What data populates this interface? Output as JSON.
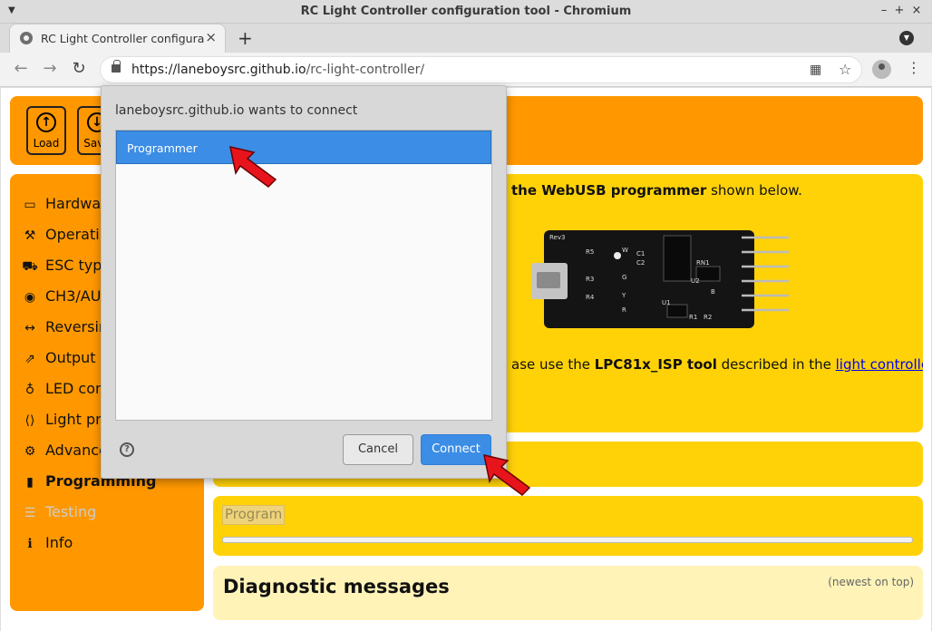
{
  "window": {
    "title": "RC Light Controller configuration tool - Chromium",
    "minimize": "–",
    "maximize": "+",
    "close": "×"
  },
  "tab": {
    "title": "RC Light Controller configuration tool",
    "close": "×",
    "new_tab": "+"
  },
  "omnibox": {
    "scheme_host": "https://laneboysrc.github.io",
    "path": "/rc-light-controller/"
  },
  "header_buttons": [
    {
      "label": "Load",
      "icon": "upload-icon"
    },
    {
      "label": "Save",
      "icon": "download-icon"
    }
  ],
  "sidebar": {
    "items": [
      {
        "label": "Hardware",
        "icon": "hdd-icon"
      },
      {
        "label": "Operating",
        "icon": "wrench-icon"
      },
      {
        "label": "ESC type",
        "icon": "car-icon"
      },
      {
        "label": "CH3/AUX",
        "icon": "toggle-icon"
      },
      {
        "label": "Reversing",
        "icon": "arrows-h-icon"
      },
      {
        "label": "Output functions",
        "icon": "external-link-icon"
      },
      {
        "label": "LED configuration",
        "icon": "lightbulb-icon"
      },
      {
        "label": "Light programs",
        "icon": "code-icon"
      },
      {
        "label": "Advanced",
        "icon": "cogs-icon"
      },
      {
        "label": "Programming",
        "icon": "microchip-icon",
        "active": true
      },
      {
        "label": "Testing",
        "icon": "sliders-icon",
        "disabled": true
      },
      {
        "label": "Info",
        "icon": "info-icon"
      }
    ]
  },
  "programming": {
    "intro_bold": "the WebUSB programmer",
    "intro_rest": " shown below.",
    "alt_prefix": "ase use the ",
    "alt_bold": "LPC81x_ISP tool",
    "alt_mid": " described in the ",
    "alt_link": "light controller",
    "board_labels": [
      "Rev3",
      "R5",
      "R3",
      "R4",
      "C1",
      "C2",
      "RN1",
      "U2",
      "U1",
      "R1",
      "R2",
      "W",
      "G",
      "Y",
      "R",
      "B"
    ],
    "program_button": "Program",
    "progress": 0
  },
  "diagnostics": {
    "title": "Diagnostic messages",
    "note": "(newest on top)"
  },
  "dialog": {
    "title": "laneboysrc.github.io wants to connect",
    "devices": [
      "Programmer"
    ],
    "help": "?",
    "cancel": "Cancel",
    "connect": "Connect"
  },
  "colors": {
    "orange": "#ff9800",
    "yellow": "#ffd208",
    "light_yellow": "#fff3b8",
    "selection_blue": "#3b8de5",
    "annotation_red": "#e8141c"
  }
}
